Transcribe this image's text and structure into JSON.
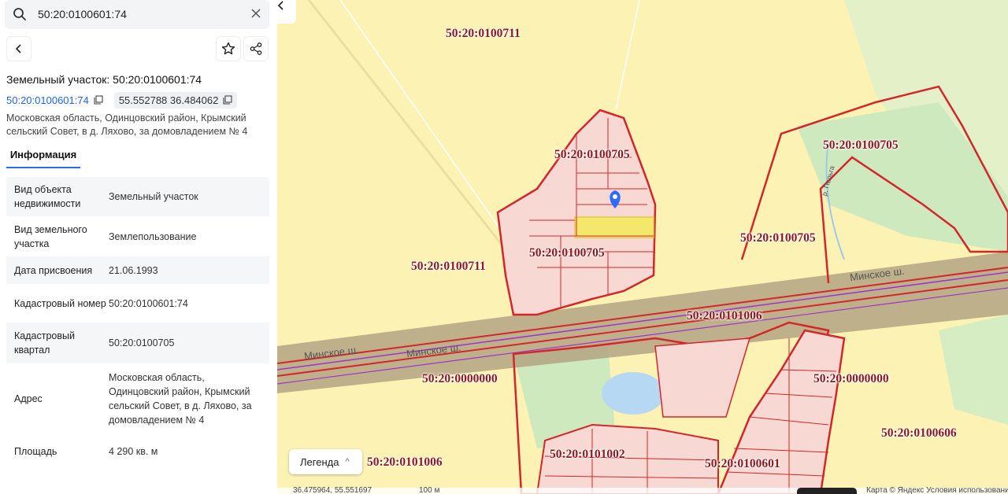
{
  "search": {
    "value": "50:20:0100601:74"
  },
  "object": {
    "title": "Земельный участок: 50:20:0100601:74",
    "cadastral_number": "50:20:0100601:74",
    "coordinates": "55.552788 36.484062",
    "address_line1": "Московская область, Одинцовский район, Крымский",
    "address_line2": "сельский Совет, в д. Ляхово, за домовладением № 4"
  },
  "tabs": [
    {
      "label": "Информация"
    }
  ],
  "info_rows": [
    {
      "key": "Вид объекта недвижимости",
      "value": "Земельный участок"
    },
    {
      "key": "Вид земельного участка",
      "value": "Землепользование"
    },
    {
      "key": "Дата присвоения",
      "value": "21.06.1993"
    },
    {
      "key": "Кадастровый номер",
      "value": "50:20:0100601:74"
    },
    {
      "key": "Кадастровый квартал",
      "value": "50:20:0100705"
    },
    {
      "key": "Адрес",
      "value": "Московская область, Одинцовский район, Крымский сельский Совет, в д. Ляхово, за домовладением № 4"
    },
    {
      "key": "Площадь",
      "value": "4 290 кв. м"
    }
  ],
  "map": {
    "cadastral_labels": [
      "50:20:0100711",
      "50:20:0100705",
      "50:20:0100705",
      "50:20:0100705",
      "50:20:0100705",
      "50:20:0100711",
      "50:20:0101006",
      "50:20:0000000",
      "50:20:0000000",
      "50:20:0100606",
      "50:20:0101006",
      "50:20:0101002",
      "50:20:0100601"
    ],
    "road_labels": [
      "Минское ш.",
      "Минское ш.",
      "Минское ш.",
      "р. Польга"
    ],
    "legend_label": "Легенда",
    "bottom_coords": "36.475964, 55.551697",
    "scale": "100 м",
    "attribution": "Карта © Яндекс  Условия использования",
    "colors": {
      "boundary": "#d4262b",
      "road": "#b3a583",
      "selected": "#f3e86b",
      "water": "#b7d8f2",
      "forest": "#cfe9bf"
    }
  }
}
